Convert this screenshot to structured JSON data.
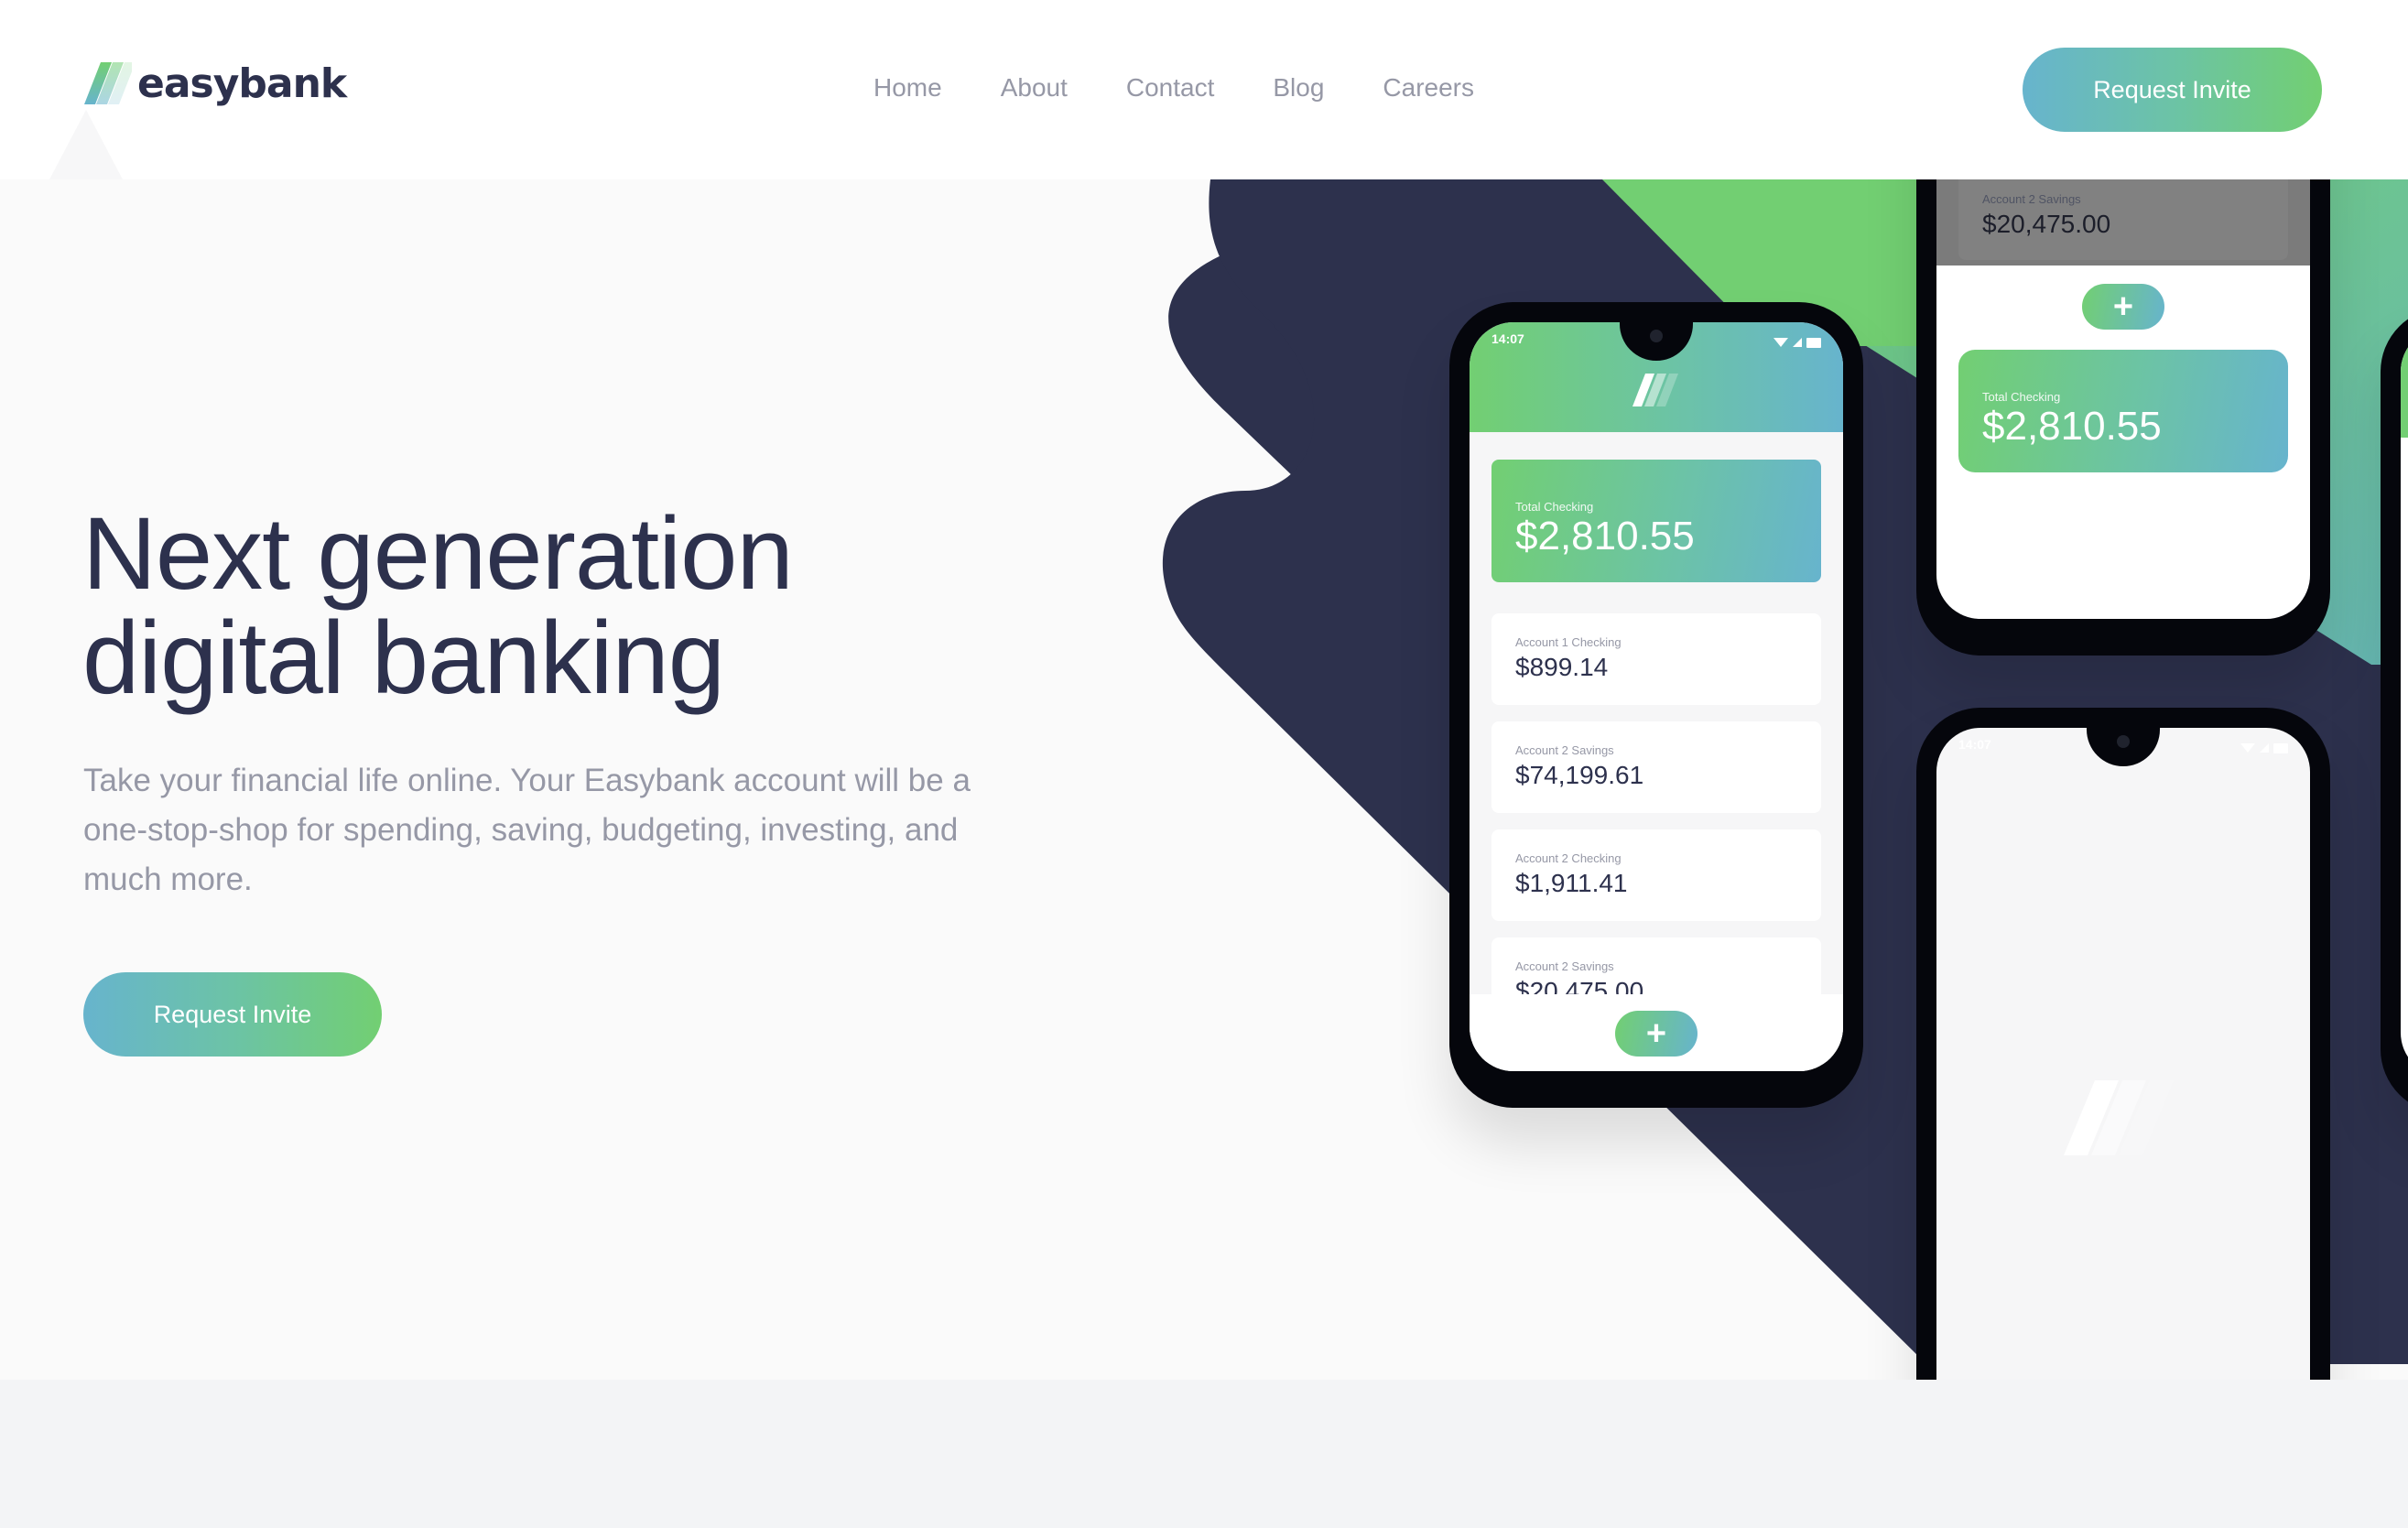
{
  "brand": {
    "name": "easybank",
    "colors": {
      "dark_blue": "#2d314d",
      "lime_green": "#72cf72",
      "bright_cyan": "#67b4cd",
      "grayish_blue": "#9698a6",
      "light_grayish_blue": "#f3f4f6",
      "very_light_gray": "#fafafa"
    }
  },
  "header": {
    "logo_icon": "easybank-logo-stripes-icon",
    "nav": [
      {
        "label": "Home"
      },
      {
        "label": "About"
      },
      {
        "label": "Contact"
      },
      {
        "label": "Blog"
      },
      {
        "label": "Careers"
      }
    ],
    "cta_label": "Request Invite"
  },
  "hero": {
    "title_line1": "Next generation",
    "title_line2": "digital banking",
    "description": "Take your financial life online. Your Easybank account will be a one-stop-shop for spending, saving, budgeting, investing, and much more.",
    "cta_label": "Request Invite"
  },
  "mockups": {
    "status_time": "14:07",
    "status_icons": [
      "wifi-icon",
      "signal-icon",
      "battery-icon"
    ],
    "total": {
      "label": "Total Checking",
      "amount": "$2,810.55"
    },
    "accounts": [
      {
        "label": "Account 1 Checking",
        "amount": "$899.14"
      },
      {
        "label": "Account 2 Savings",
        "amount": "$74,199.61"
      },
      {
        "label": "Account 2 Checking",
        "amount": "$1,911.41"
      },
      {
        "label": "Account 2 Savings",
        "amount": "$20,475.00"
      }
    ],
    "fab_symbol": "+"
  }
}
